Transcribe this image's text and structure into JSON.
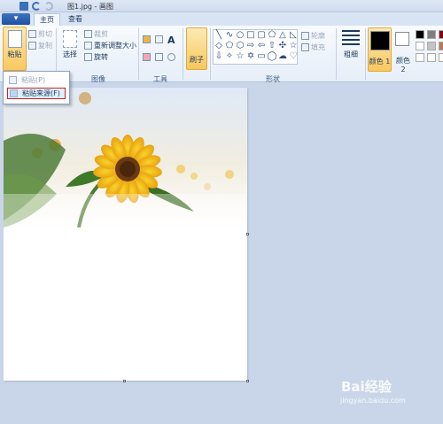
{
  "window": {
    "title": "图1.jpg - 画图"
  },
  "tabs": {
    "home": "主页",
    "view": "查看"
  },
  "ribbon": {
    "clipboard": {
      "paste": "粘贴",
      "cut": "剪切",
      "copy": "复制"
    },
    "image": {
      "select": "选择",
      "crop": "裁剪",
      "resize": "重新调整大小",
      "rotate": "旋转",
      "label": "图像"
    },
    "tools": {
      "label": "工具"
    },
    "brushes": {
      "label": "刷子"
    },
    "shapes": {
      "outline": "轮廓",
      "fill": "填充",
      "label": "形状"
    },
    "size": {
      "label": "粗细"
    },
    "colors": {
      "color1": "颜色 1",
      "color2": "颜色 2",
      "color1_value": "#000000",
      "color2_value": "#ffffff"
    }
  },
  "paste_menu": {
    "paste": "粘贴(P)",
    "paste_from": "粘贴来源(F)"
  },
  "watermark": {
    "text": "Bai经验",
    "sub": "jingyan.baidu.com"
  }
}
